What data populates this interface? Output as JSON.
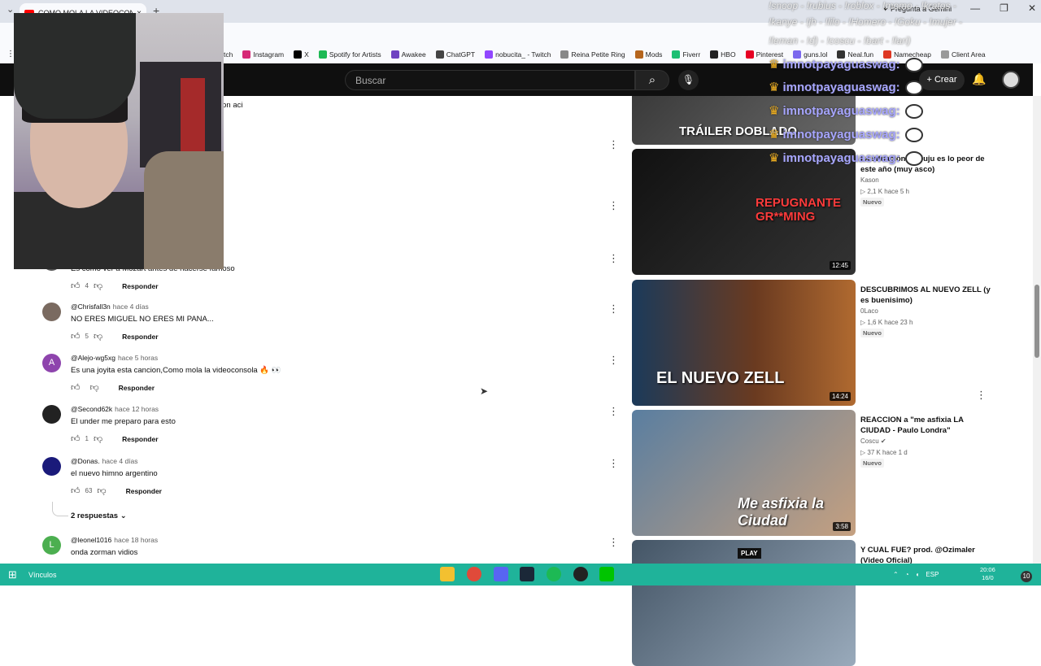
{
  "browser": {
    "tab_title": "COMO MOLA LA VIDEOCONSO",
    "tab_close": "×",
    "new_tab": "+",
    "gemini_label": "✦ Pregunta a Gemini",
    "bookmarks": [
      {
        "label": "tch",
        "color": "#ffffff"
      },
      {
        "label": "Instagram",
        "color": "#d62976"
      },
      {
        "label": "X",
        "color": "#000000"
      },
      {
        "label": "Spotify for Artists",
        "color": "#1db954"
      },
      {
        "label": "Awakee",
        "color": "#6f42c1"
      },
      {
        "label": "ChatGPT",
        "color": "#444444"
      },
      {
        "label": "nobucita_ - Twitch",
        "color": "#9146ff"
      },
      {
        "label": "Reina Petite Ring",
        "color": "#888888"
      },
      {
        "label": "Mods",
        "color": "#b5651d"
      },
      {
        "label": "Fiverr",
        "color": "#1dbf73"
      },
      {
        "label": "HBO",
        "color": "#222222"
      },
      {
        "label": "Pinterest",
        "color": "#e60023"
      },
      {
        "label": "guns.lol",
        "color": "#7b68ee"
      },
      {
        "label": "Neal.fun",
        "color": "#333333"
      },
      {
        "label": "Namecheap",
        "color": "#de3723"
      },
      {
        "label": "Client Area",
        "color": "#999999"
      }
    ]
  },
  "masthead": {
    "search_placeholder": "Buscar",
    "create_label": "+ Crear"
  },
  "partial_comment_text": "ion aci",
  "comments": [
    {
      "author": "",
      "time": "",
      "text": "Es como ver a Mozart antes de hacerse famoso",
      "likes": "4",
      "avatar_color": "#555555",
      "avatar_letter": ""
    },
    {
      "author": "@Chrisfall3n",
      "time": "hace 4 días",
      "text": "NO ERES MIGUEL NO ERES MI PANA...",
      "likes": "5",
      "avatar_color": "#7a6a60",
      "avatar_letter": ""
    },
    {
      "author": "@Alejo-wg5xg",
      "time": "hace 5 horas",
      "text": "Es una joyita esta cancion,Como mola la videoconsola 🔥 👀",
      "likes": "",
      "avatar_color": "#8e44ad",
      "avatar_letter": "A"
    },
    {
      "author": "@Second62k",
      "time": "hace 12 horas",
      "text": "El under me preparo para esto",
      "likes": "1",
      "avatar_color": "#222222",
      "avatar_letter": ""
    },
    {
      "author": "@Donas.",
      "time": "hace 4 días",
      "text": "el nuevo himno argentino",
      "likes": "63",
      "avatar_color": "#1a1a7a",
      "avatar_letter": ""
    },
    {
      "author": "@leonel1016",
      "time": "hace 18 horas",
      "text": "onda zorman vidios",
      "likes": "",
      "avatar_color": "#4caf50",
      "avatar_letter": "L"
    }
  ],
  "reply_label": "Responder",
  "replies_toggle": "2 respuestas",
  "videos": [
    {
      "title": "",
      "channel": "",
      "stats": "",
      "badge": "",
      "duration": "",
      "caption": "TRÁILER DOBLADO"
    },
    {
      "title": "La situación de Juju es lo peor de este año (muy asco)",
      "channel": "Kason",
      "stats": "▷ 2,1 K  hace 5 h",
      "badge": "Nuevo",
      "duration": "12:45",
      "caption": "REPUGNANTE GR**MING"
    },
    {
      "title": "DESCUBRIMOS AL NUEVO ZELL (y es buenisimo)",
      "channel": "0Laco",
      "stats": "▷ 1,6 K  hace 23 h",
      "badge": "Nuevo",
      "duration": "14:24",
      "caption": "EL NUEVO ZELL"
    },
    {
      "title": "REACCION a \"me asfixia LA CIUDAD - Paulo Londra\"",
      "channel": "Coscu ✔",
      "stats": "▷ 37 K  hace 1 d",
      "badge": "Nuevo",
      "duration": "3:58",
      "caption": "Me asfixia la Ciudad"
    },
    {
      "title": "Y CUAL FUE? prod. @Ozimaler (Video Oficial)",
      "channel": "",
      "stats": "",
      "badge": "",
      "duration": "",
      "caption": "PLAY"
    }
  ],
  "chat_overlay": {
    "user": "imnotpayaguaswag",
    "names_row1": "!snoop - !rubius - !roblox - !momo - !kratos -",
    "names_row2": "!kanye - !jh - !lilo - !Homero - !Goku - !mujer -",
    "names_row3": "!leman - !d) - !coscu - !bart - !lari)"
  },
  "taskbar": {
    "vinculos": "Vínculos",
    "lang": "ESP",
    "time": "20:06",
    "date": "16/0",
    "notif": "10"
  }
}
